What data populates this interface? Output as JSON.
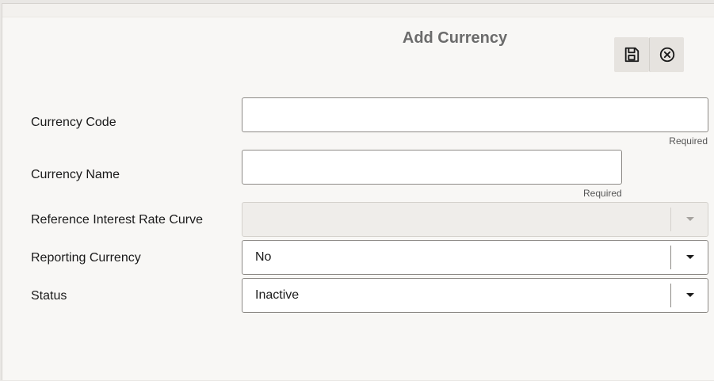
{
  "dialog": {
    "title": "Add Currency",
    "toolbar": {
      "save_icon": "save-icon",
      "cancel_icon": "close-circle-icon"
    }
  },
  "form": {
    "currency_code": {
      "label": "Currency Code",
      "value": "",
      "required_text": "Required"
    },
    "currency_name": {
      "label": "Currency Name",
      "value": "",
      "required_text": "Required"
    },
    "reference_interest_rate_curve": {
      "label": "Reference Interest Rate Curve",
      "value": "",
      "disabled": true
    },
    "reporting_currency": {
      "label": "Reporting Currency",
      "value": "No"
    },
    "status": {
      "label": "Status",
      "value": "Inactive"
    }
  },
  "colors": {
    "title": "#6b6b6b",
    "background": "#f8f7f5",
    "border": "#8d8a86",
    "toolbar_button": "#e6e3df"
  }
}
